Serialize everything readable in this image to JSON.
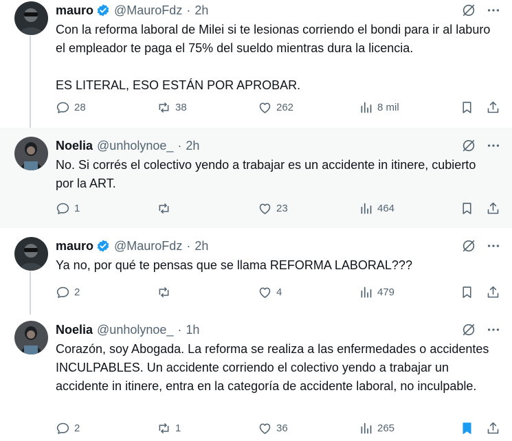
{
  "tweets": [
    {
      "author": "mauro",
      "handle": "@MauroFdz",
      "time": "2h",
      "verified": true,
      "text": "Con la reforma laboral de Milei si te lesionas corriendo el bondi para ir al laburo el empleador te paga el 75% del sueldo mientras dura la licencia.\n\nES LITERAL, ESO ESTÁN POR APROBAR.",
      "replies": "28",
      "reposts": "38",
      "likes": "262",
      "views": "8 mil",
      "bookmarked": false
    },
    {
      "author": "Noelia",
      "handle": "@unholynoe_",
      "time": "2h",
      "verified": false,
      "text": "No. Si corrés el colectivo yendo a trabajar es un accidente in itinere, cubierto por la ART.",
      "replies": "1",
      "reposts": "",
      "likes": "23",
      "views": "464",
      "bookmarked": false
    },
    {
      "author": "mauro",
      "handle": "@MauroFdz",
      "time": "2h",
      "verified": true,
      "text": "Ya no, por qué te pensas que se llama REFORMA LABORAL???",
      "replies": "2",
      "reposts": "",
      "likes": "4",
      "views": "479",
      "bookmarked": false
    },
    {
      "author": "Noelia",
      "handle": "@unholynoe_",
      "time": "1h",
      "verified": false,
      "text": "Corazón, soy Abogada. La reforma se realiza a las enfermedades o accidentes INCULPABLES. Un accidente corriendo el colectivo yendo a trabajar un accidente in itinere, entra en la categoría de accidente laboral, no inculpable.",
      "replies": "2",
      "reposts": "1",
      "likes": "36",
      "views": "265",
      "bookmarked": true
    }
  ],
  "colors": {
    "text": "#0f1419",
    "secondary": "#536471",
    "verified_blue": "#1d9bf0",
    "highlight_bg": "#f7f9f9",
    "thread_line": "#cfd9de"
  },
  "icons": [
    "verified-badge-icon",
    "grok-icon",
    "more-icon",
    "reply-icon",
    "repost-icon",
    "like-icon",
    "views-icon",
    "bookmark-icon",
    "share-icon"
  ]
}
